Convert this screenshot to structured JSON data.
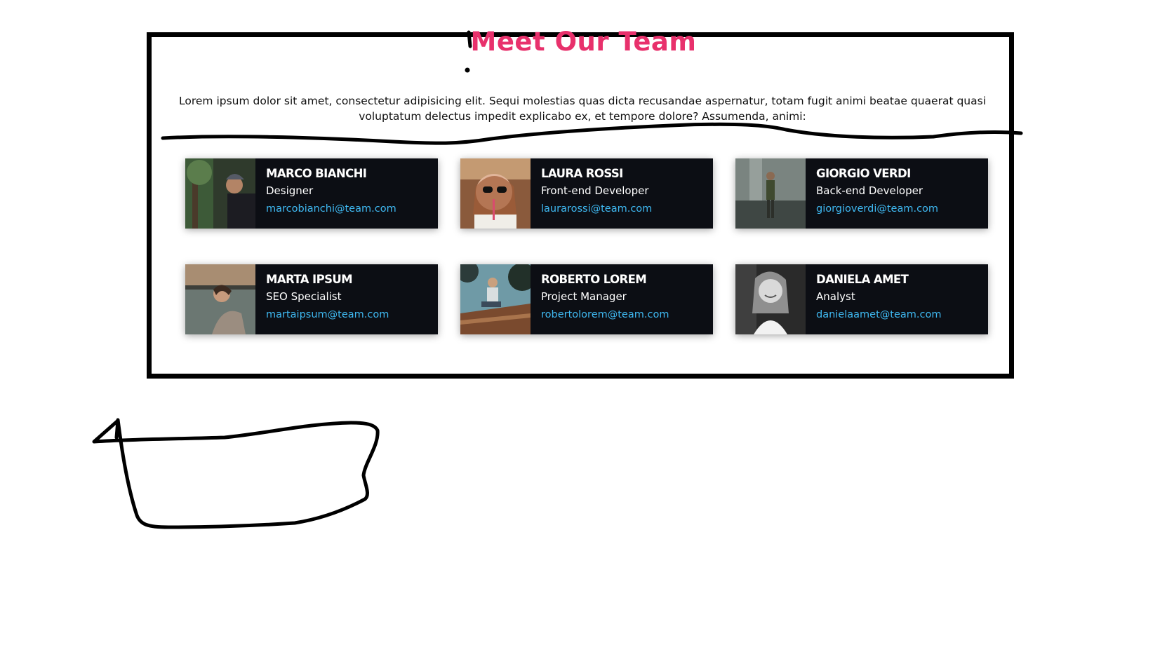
{
  "section": {
    "title": "Meet Our Team",
    "intro": "Lorem ipsum dolor sit amet, consectetur adipisicing elit. Sequi molestias quas dicta recusandae aspernatur, totam fugit animi beatae quaerat quasi voluptatum delectus impedit explicabo ex, et tempore dolore? Assumenda, animi:"
  },
  "colors": {
    "title": "#e8316c",
    "card_bg": "#0c0e14",
    "email": "#3fb9f2"
  },
  "team": [
    {
      "name": "MARCO BIANCHI",
      "role": "Designer",
      "email": "marcobianchi@team.com",
      "photo": "man-in-beanie-forest-photo"
    },
    {
      "name": "LAURA ROSSI",
      "role": "Front-end Developer",
      "email": "laurarossi@team.com",
      "photo": "woman-sunglasses-drink-photo"
    },
    {
      "name": "GIORGIO VERDI",
      "role": "Back-end Developer",
      "email": "giorgioverdi@team.com",
      "photo": "man-waterfall-photo"
    },
    {
      "name": "MARTA IPSUM",
      "role": "SEO Specialist",
      "email": "martaipsum@team.com",
      "photo": "woman-lake-sunset-photo"
    },
    {
      "name": "ROBERTO LOREM",
      "role": "Project Manager",
      "email": "robertolorem@team.com",
      "photo": "man-sitting-boat-photo"
    },
    {
      "name": "DANIELA AMET",
      "role": "Analyst",
      "email": "danielaamet@team.com",
      "photo": "smiling-woman-bw-photo"
    }
  ]
}
